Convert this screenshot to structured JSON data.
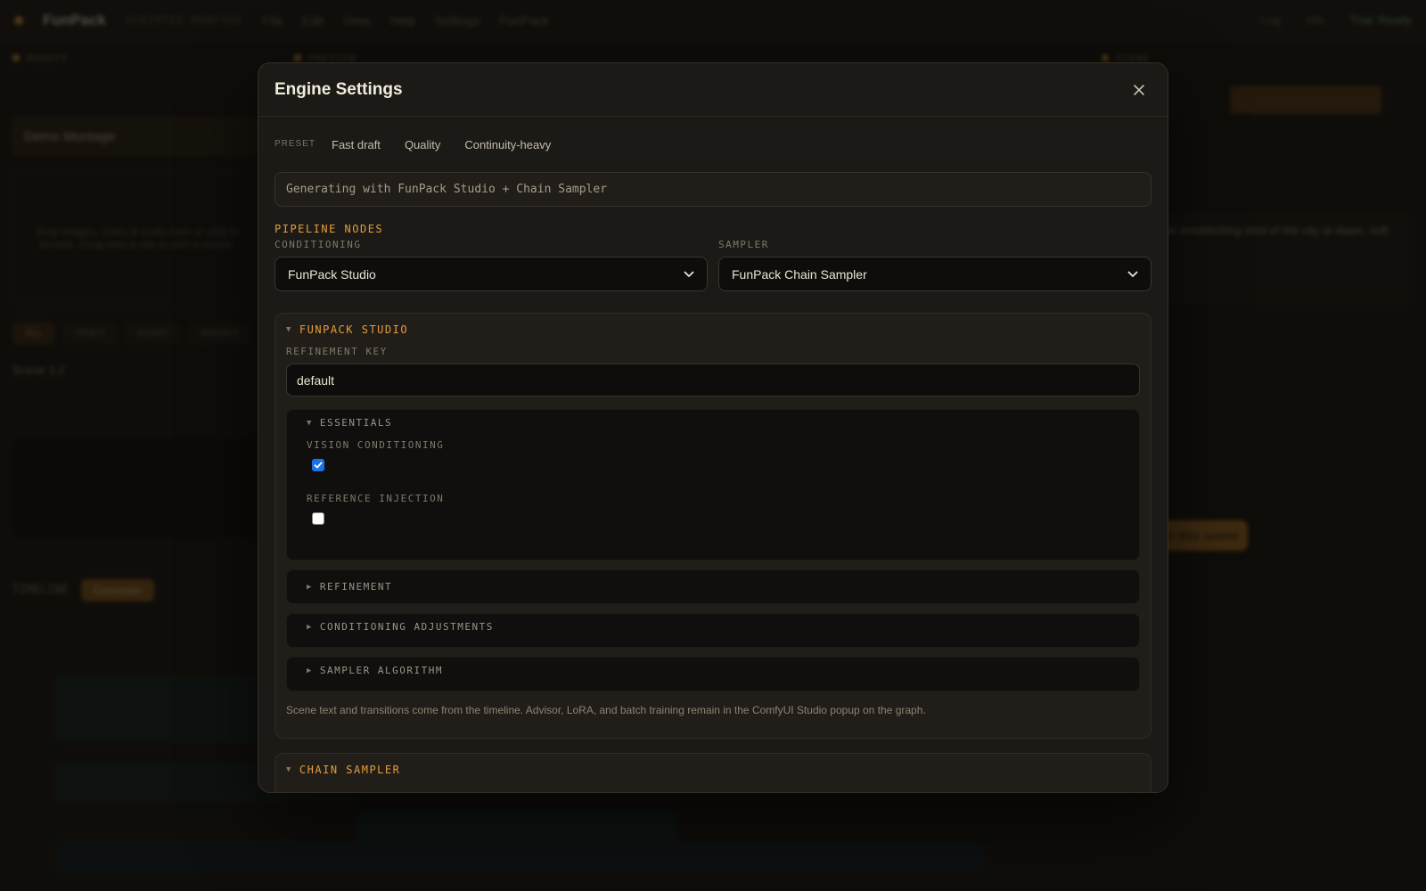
{
  "background": {
    "app_name": "FunPack",
    "app_tagline": "SCRIPTED MONTAGE",
    "menu": [
      "File",
      "Edit",
      "View",
      "Help",
      "Settings",
      "FunPack"
    ],
    "top_right": [
      "Log",
      "Info",
      "Trial: Ready"
    ],
    "panels": {
      "left": "ASSETS",
      "center": "PREVIEW",
      "right": "SCENE"
    },
    "left": {
      "project": "Demo Montage",
      "drop_text": "Drop images, video & audio here or click to browse. Drag onto a row to add to scene.",
      "tabs": [
        "ALL",
        "VIDEO",
        "AUDIO",
        "IMAGES"
      ],
      "scene_label": "Scene 3.2"
    },
    "timeline": {
      "label": "TIMELINE",
      "generate": "Generate"
    },
    "right": {
      "prompt": "Wide establishing shot of the city at dawn, soft",
      "cta": "Gen this scene"
    }
  },
  "modal": {
    "title": "Engine Settings",
    "preset_label": "PRESET",
    "presets": [
      "Fast draft",
      "Quality",
      "Continuity-heavy"
    ],
    "status": "Generating with FunPack Studio + Chain Sampler",
    "pipeline_title": "PIPELINE NODES",
    "conditioning_label": "CONDITIONING",
    "conditioning_value": "FunPack Studio",
    "sampler_label": "SAMPLER",
    "sampler_value": "FunPack Chain Sampler",
    "studio": {
      "title": "FUNPACK STUDIO",
      "refinement_key_label": "REFINEMENT KEY",
      "refinement_key_value": "default",
      "essentials": {
        "title": "ESSENTIALS",
        "vision_label": "VISION CONDITIONING",
        "vision_checked": true,
        "reference_label": "REFERENCE INJECTION",
        "reference_checked": false
      },
      "collapsed_sections": [
        "REFINEMENT",
        "CONDITIONING ADJUSTMENTS",
        "SAMPLER ALGORITHM"
      ],
      "note": "Scene text and transitions come from the timeline. Advisor, LoRA, and batch training remain in the ComfyUI Studio popup on the graph."
    },
    "chain_sampler_title": "CHAIN SAMPLER"
  }
}
